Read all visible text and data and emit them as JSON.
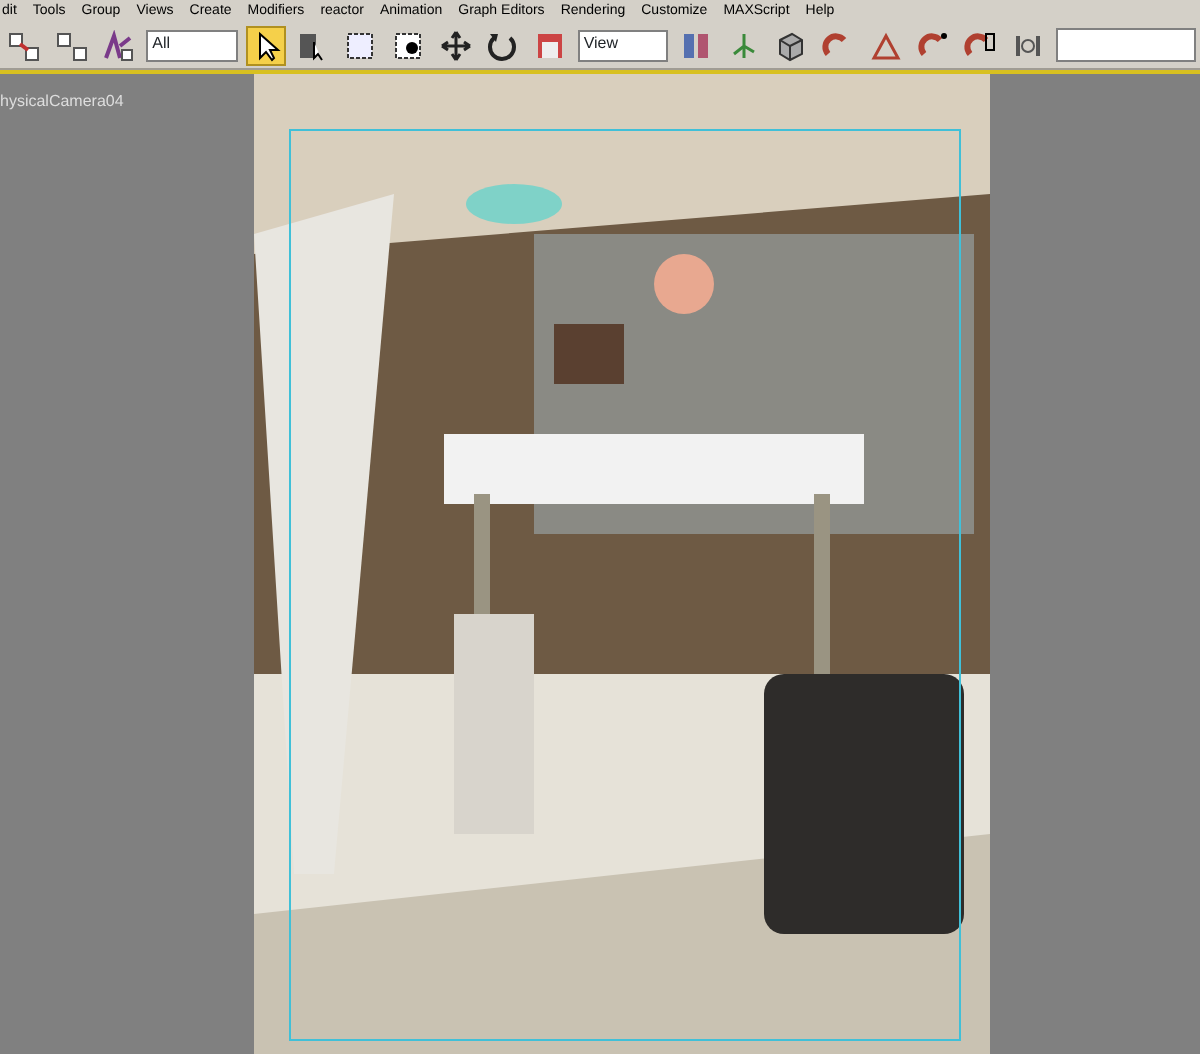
{
  "menu_bar": {
    "items": [
      "dit",
      "Tools",
      "Group",
      "Views",
      "Create",
      "Modifiers",
      "reactor",
      "Animation",
      "Graph Editors",
      "Rendering",
      "Customize",
      "MAXScript",
      "Help"
    ]
  },
  "toolbar": {
    "tools": [
      {
        "kind": "button",
        "selected": false
      },
      {
        "kind": "button",
        "selected": false
      },
      {
        "kind": "button",
        "selected": false
      },
      {
        "kind": "dropdown",
        "value": "All"
      },
      {
        "kind": "button",
        "selected": true
      },
      {
        "kind": "button",
        "selected": false
      },
      {
        "kind": "button",
        "selected": false
      },
      {
        "kind": "button",
        "selected": false
      },
      {
        "kind": "button",
        "selected": false
      },
      {
        "kind": "button",
        "selected": false
      },
      {
        "kind": "button",
        "selected": false
      },
      {
        "kind": "dropdown",
        "value": "View"
      },
      {
        "kind": "button",
        "selected": false
      },
      {
        "kind": "button",
        "selected": false
      },
      {
        "kind": "button",
        "selected": false
      },
      {
        "kind": "button",
        "selected": false
      },
      {
        "kind": "button",
        "selected": false
      },
      {
        "kind": "button",
        "selected": false
      },
      {
        "kind": "button",
        "selected": false
      },
      {
        "kind": "button",
        "selected": false
      },
      {
        "kind": "field"
      }
    ]
  },
  "viewport": {
    "label": "hysicalCamera04"
  }
}
